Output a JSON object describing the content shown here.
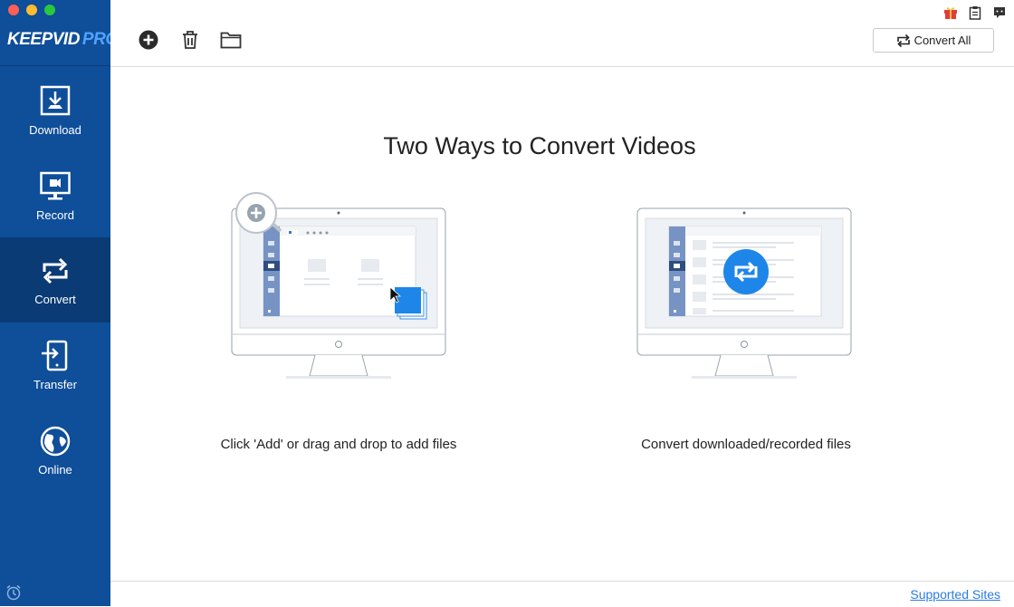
{
  "app": {
    "logo_main": "KEEPVID",
    "logo_pro": "PRO"
  },
  "sidebar": {
    "items": [
      {
        "label": "Download",
        "icon": "download-icon",
        "active": false
      },
      {
        "label": "Record",
        "icon": "record-icon",
        "active": false
      },
      {
        "label": "Convert",
        "icon": "convert-icon",
        "active": true
      },
      {
        "label": "Transfer",
        "icon": "transfer-icon",
        "active": false
      },
      {
        "label": "Online",
        "icon": "online-icon",
        "active": false
      }
    ]
  },
  "toolbar": {
    "add_icon": "plus-circle-icon",
    "delete_icon": "trash-icon",
    "folder_icon": "folder-icon",
    "convert_all_label": "Convert All"
  },
  "main": {
    "headline": "Two Ways to Convert Videos",
    "left_caption": "Click 'Add' or drag and drop to add files",
    "right_caption": "Convert downloaded/recorded files"
  },
  "footer": {
    "link_label": "Supported Sites"
  },
  "colors": {
    "sidebar_bg": "#0f4e98",
    "sidebar_active": "#0b3b74",
    "accent": "#1e86e8",
    "link": "#2a7be4"
  }
}
